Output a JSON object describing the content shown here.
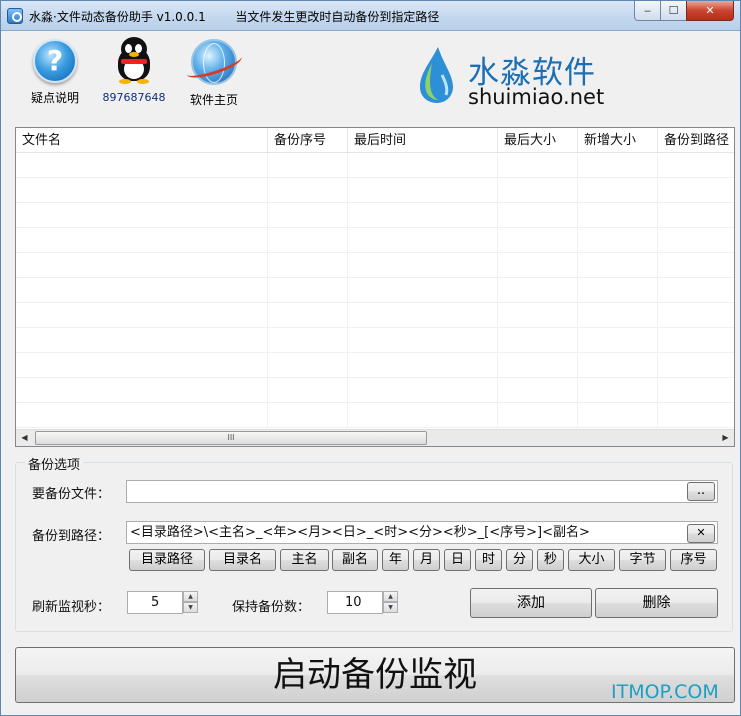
{
  "window": {
    "title": "水淼·文件动态备份助手 v1.0.0.1",
    "subtitle": "当文件发生更改时自动备份到指定路径",
    "min_label": "‒",
    "max_label": "☐",
    "close_label": "✕"
  },
  "toolbar": {
    "help_label": "疑点说明",
    "help_glyph": "?",
    "qq_label": "897687648",
    "home_label": "软件主页"
  },
  "brand": {
    "cn": "水淼软件",
    "en": "shuimiao.net",
    "color": "#1c6fb4"
  },
  "table": {
    "columns": [
      "文件名",
      "备份序号",
      "最后时间",
      "最后大小",
      "新增大小",
      "备份到路径"
    ],
    "rows": [],
    "scroll_thumb": "III",
    "scroll_left": "◀",
    "scroll_right": "▶"
  },
  "options": {
    "group_title": "备份选项",
    "file_label": "要备份文件：",
    "file_value": "",
    "browse_label": "..",
    "path_label": "备份到路径：",
    "path_value": "<目录路径>\\<主名>_<年><月><日>_<时><分><秒>_[<序号>]<副名>",
    "clear_label": "✕",
    "tokens": [
      "目录路径",
      "目录名",
      "主名",
      "副名",
      "年",
      "月",
      "日",
      "时",
      "分",
      "秒",
      "大小",
      "字节",
      "序号"
    ],
    "refresh_label": "刷新监视秒：",
    "refresh_value": "5",
    "keep_label": "保持备份数：",
    "keep_value": "10",
    "add_label": "添加",
    "delete_label": "删除",
    "spin_up": "▲",
    "spin_down": "▼"
  },
  "start_label": "启动备份监视",
  "watermark": "ITMOP.COM"
}
